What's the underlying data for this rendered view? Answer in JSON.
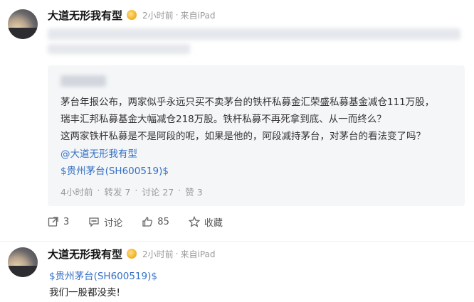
{
  "posts": [
    {
      "username": "大道无形我有型",
      "time": "2小时前",
      "source": "来自iPad",
      "quote": {
        "lines": [
          "茅台年报公布，两家似乎永远只买不卖茅台的铁杆私募金汇荣盛私募基金减仓111万股，",
          "瑞丰汇邦私募基金大幅减仓218万股。铁杆私募不再死拿到底、从一而终么？",
          "这两家铁杆私募是不是阿段的呢，如果是他的，阿段减持茅台，对茅台的看法变了吗？"
        ],
        "mention": "@大道无形我有型",
        "stock": "$贵州茅台(SH600519)$",
        "time": "4小时前",
        "reposts": "转发 7",
        "comments": "讨论 27",
        "likes": "赞 3"
      },
      "actions": {
        "repost_count": "3",
        "comment_label": "讨论",
        "like_count": "85",
        "favorite_label": "收藏"
      }
    },
    {
      "username": "大道无形我有型",
      "time": "2小时前",
      "source": "来自iPad",
      "stock": "$贵州茅台(SH600519)$",
      "text": "我们一股都没卖!"
    }
  ],
  "colors": {
    "link": "#3470c5",
    "meta": "#999999",
    "quote_bg": "#f5f6f8"
  }
}
